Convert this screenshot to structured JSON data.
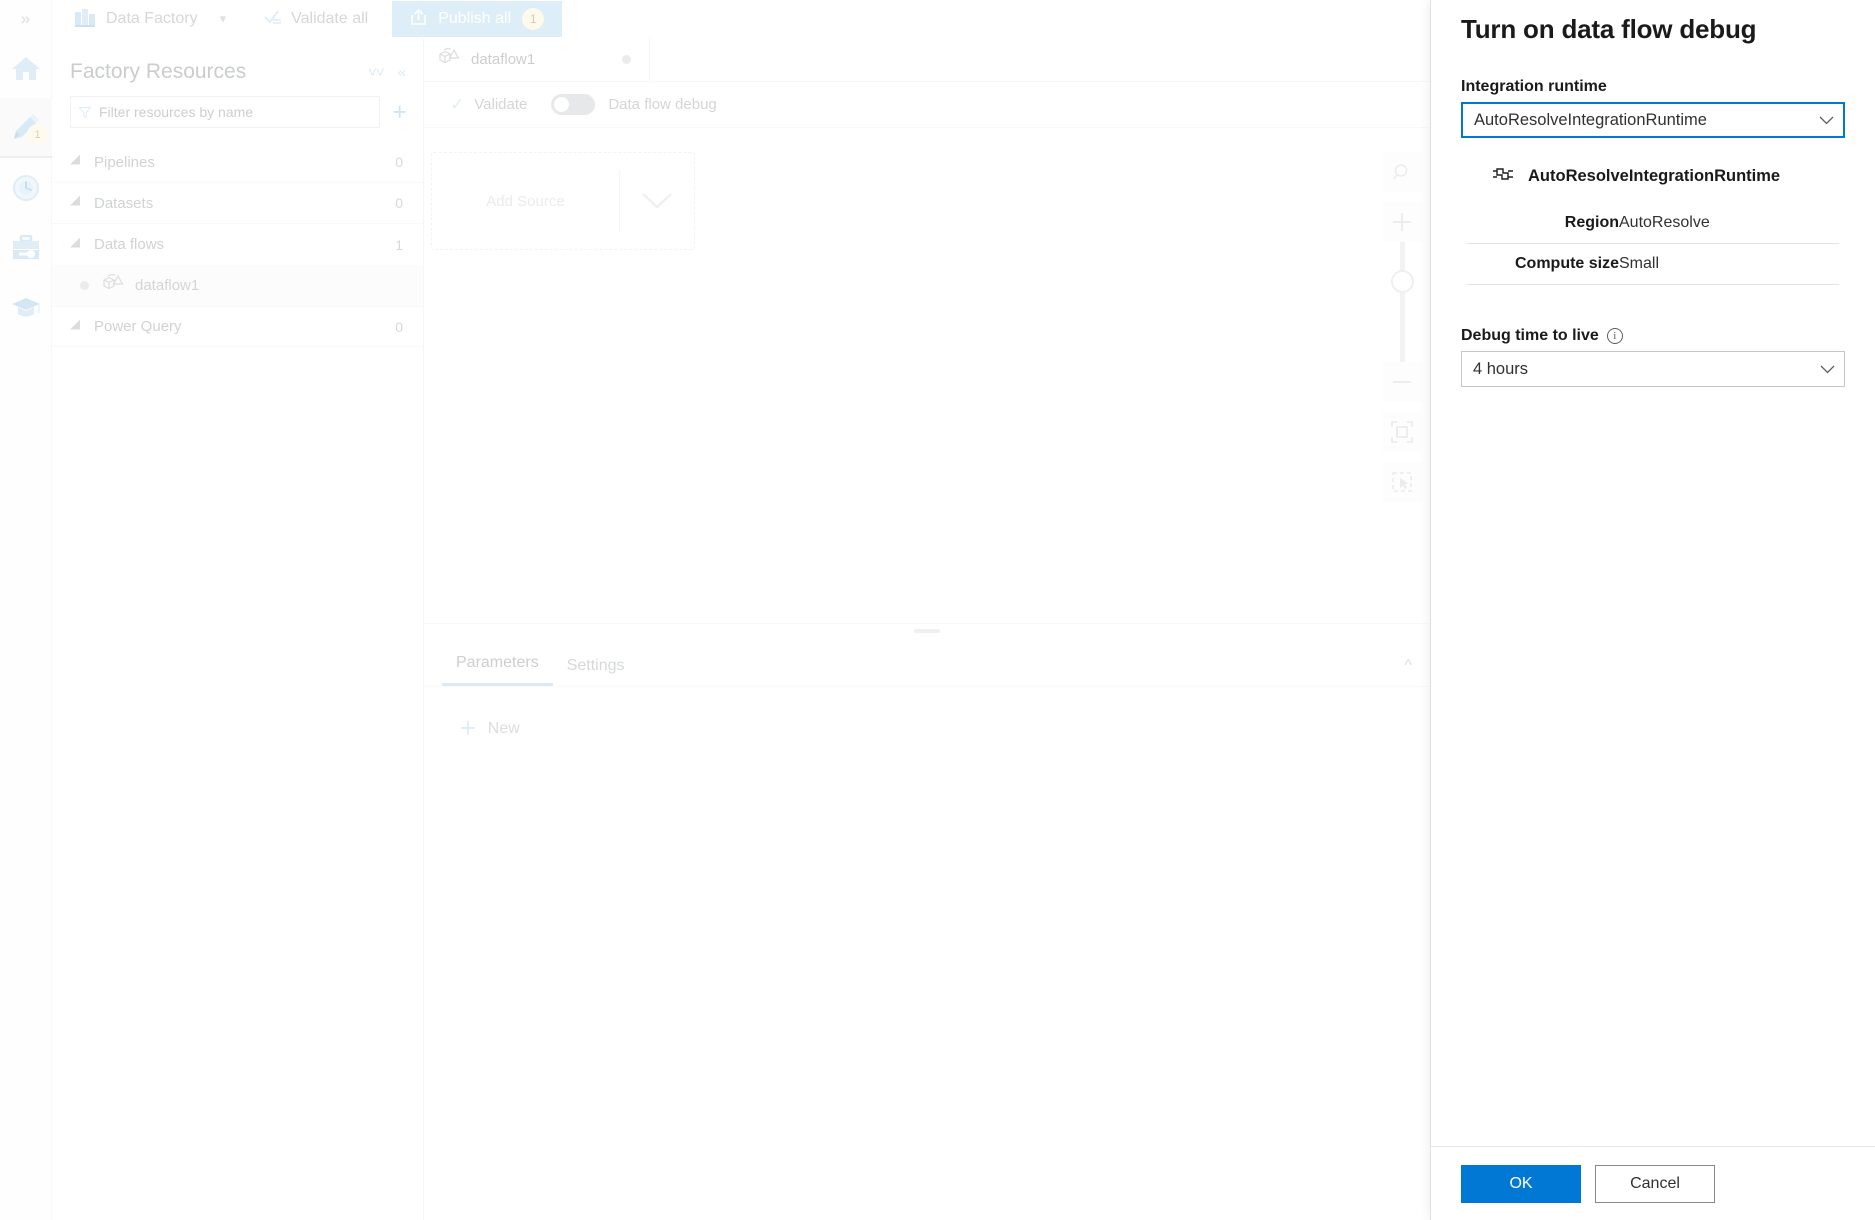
{
  "topbar": {
    "expand_icon": "double-chevron-right-icon",
    "product": "Data Factory",
    "product_chevron": "chevron-down-icon",
    "validate_all": "Validate all",
    "publish_all": "Publish all",
    "publish_count": "1",
    "publish_bg": "#9fd0ef",
    "publish_badge_bg": "#faf0c8"
  },
  "rail": {
    "items": [
      {
        "name": "home-icon",
        "label": "Home"
      },
      {
        "name": "author-pencil-icon",
        "label": "Author",
        "badge": "1"
      },
      {
        "name": "monitor-gauge-icon",
        "label": "Monitor"
      },
      {
        "name": "manage-toolbox-icon",
        "label": "Manage"
      },
      {
        "name": "learning-cap-icon",
        "label": "Learning center"
      }
    ]
  },
  "sidebar": {
    "title": "Factory Resources",
    "collapse_all_icon": "double-chevron-down-icon",
    "collapse_panel_icon": "double-chevron-left-icon",
    "filter_placeholder": "Filter resources by name",
    "add_label": "+",
    "tree": [
      {
        "label": "Pipelines",
        "count": "0"
      },
      {
        "label": "Datasets",
        "count": "0"
      },
      {
        "label": "Data flows",
        "count": "1"
      },
      {
        "label": "Power Query",
        "count": "0"
      }
    ],
    "selected_child": "dataflow1"
  },
  "editor": {
    "tab_name": "dataflow1",
    "validate": "Validate",
    "data_flow_debug": "Data flow debug",
    "debug_toggle_on": false,
    "add_source": "Add Source",
    "zoom_tools": [
      "search-zoom-icon",
      "zoom-in-plus-icon",
      "zoom-slider",
      "zoom-out-minus-icon",
      "fit-to-screen-icon",
      "select-marquee-icon"
    ],
    "bottom_tabs": [
      {
        "label": "Parameters",
        "active": true
      },
      {
        "label": "Settings",
        "active": false
      }
    ],
    "collapse_icon": "chevron-up-icon",
    "new_label": "New"
  },
  "panel": {
    "title": "Turn on data flow debug",
    "integration_runtime_label": "Integration runtime",
    "integration_runtime_value": "AutoResolveIntegrationRuntime",
    "runtime_card": {
      "icon": "integration-runtime-icon",
      "name": "AutoResolveIntegrationRuntime",
      "rows": [
        {
          "key": "Region",
          "value": "AutoResolve"
        },
        {
          "key": "Compute size",
          "value": "Small"
        }
      ]
    },
    "ttl_label": "Debug time to live",
    "ttl_info_icon": "info-icon",
    "ttl_value": "4 hours",
    "ok_label": "OK",
    "cancel_label": "Cancel",
    "accent_color": "#0078d4",
    "focus_border_color": "#0078d4"
  }
}
